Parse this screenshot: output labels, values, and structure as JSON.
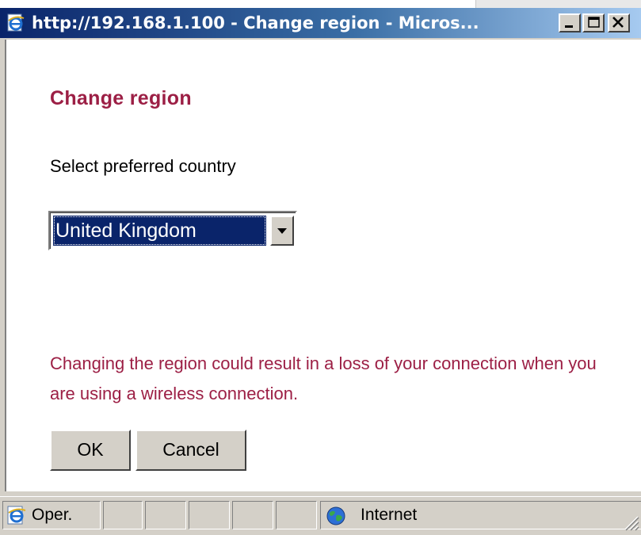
{
  "window": {
    "title": "http://192.168.1.100 - Change region - Micros..."
  },
  "page": {
    "heading": "Change region",
    "prompt": "Select preferred country",
    "country_select": {
      "selected": "United Kingdom"
    },
    "warning_text": "Changing the region could result in a loss of your connection when you are using a wireless connection.",
    "buttons": {
      "ok_label": "OK",
      "cancel_label": "Cancel"
    }
  },
  "statusbar": {
    "status_text": "Oper.",
    "zone_text": "Internet"
  },
  "colors": {
    "accent": "#9c1f45",
    "titlebar_start": "#0a246a",
    "titlebar_end": "#a6caf0",
    "selection": "#0a246a"
  },
  "icons": {
    "title": "ie-page-icon",
    "status": "ie-page-icon",
    "zone": "globe-icon"
  }
}
